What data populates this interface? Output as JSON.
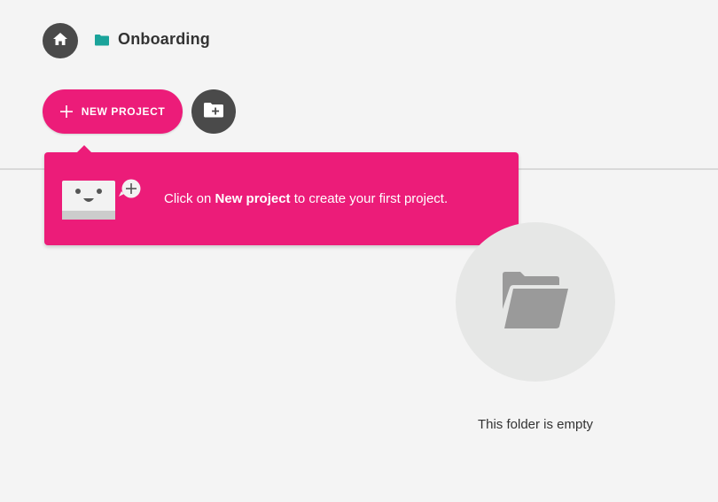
{
  "breadcrumb": {
    "home_icon": "home-icon",
    "folder_icon": "folder-icon",
    "folder_icon_color": "#1aa39a",
    "current_folder": "Onboarding"
  },
  "toolbar": {
    "new_project_label": "NEW PROJECT",
    "new_project_icon": "plus-icon",
    "new_folder_icon": "folder-plus-icon"
  },
  "tooltip": {
    "prefix": "Click on ",
    "emphasis": "New project",
    "suffix": " to create your first project.",
    "illustration": "bot-with-plus-bubble"
  },
  "empty_state": {
    "icon": "open-folder-icon",
    "message": "This folder is empty"
  },
  "colors": {
    "accent": "#ec1c79",
    "dark_button": "#4a4a4a",
    "background": "#f4f4f4",
    "empty_circle": "#e6e7e6"
  }
}
